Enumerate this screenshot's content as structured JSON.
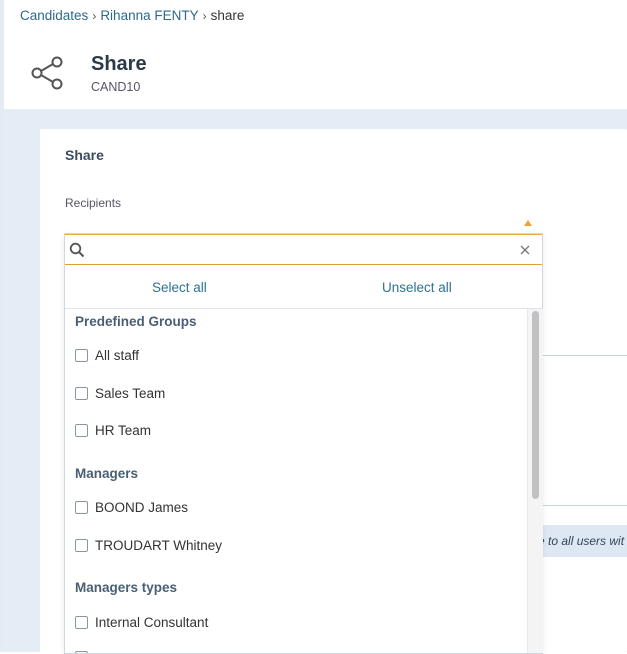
{
  "breadcrumb": {
    "items": [
      {
        "label": "Candidates"
      },
      {
        "label": "Rihanna FENTY"
      },
      {
        "label": "share"
      }
    ]
  },
  "header": {
    "icon": "share-icon",
    "title": "Share",
    "subtitle": "CAND10"
  },
  "card": {
    "title": "Share",
    "recipients_label": "Recipients",
    "info_text": "e to all users wit"
  },
  "dropdown": {
    "search_value": "",
    "select_all": "Select all",
    "unselect_all": "Unselect all",
    "groups": [
      {
        "title": "Predefined Groups",
        "options": [
          {
            "label": "All staff",
            "checked": false
          },
          {
            "label": "Sales Team",
            "checked": false
          },
          {
            "label": "HR Team",
            "checked": false
          }
        ]
      },
      {
        "title": "Managers",
        "options": [
          {
            "label": "BOOND James",
            "checked": false
          },
          {
            "label": "TROUDART Whitney",
            "checked": false
          }
        ]
      },
      {
        "title": "Managers types",
        "options": [
          {
            "label": "Internal Consultant",
            "checked": false
          }
        ]
      }
    ]
  },
  "colors": {
    "link": "#2c6a8c",
    "accent": "#f0a030",
    "background": "#e4ecf5"
  }
}
